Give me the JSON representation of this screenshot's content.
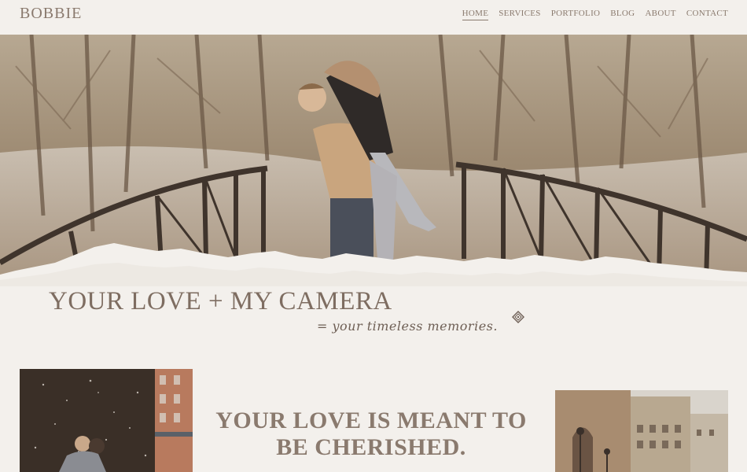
{
  "brand": "BOBBIE",
  "nav": {
    "home": "HOME",
    "services": "SERVICES",
    "portfolio": "PORTFOLIO",
    "blog": "BLOG",
    "about": "ABOUT",
    "contact": "CONTACT"
  },
  "hero": {
    "tagline": "YOUR LOVE + MY CAMERA",
    "subtagline": "= your timeless memories."
  },
  "section": {
    "heading_line1": "YOUR LOVE IS MEANT TO",
    "heading_line2": "BE CHERISHED."
  },
  "colors": {
    "background": "#f3f0ec",
    "text": "#7e6d61"
  },
  "icons": {
    "ornament": "diamond-ornament-icon"
  }
}
